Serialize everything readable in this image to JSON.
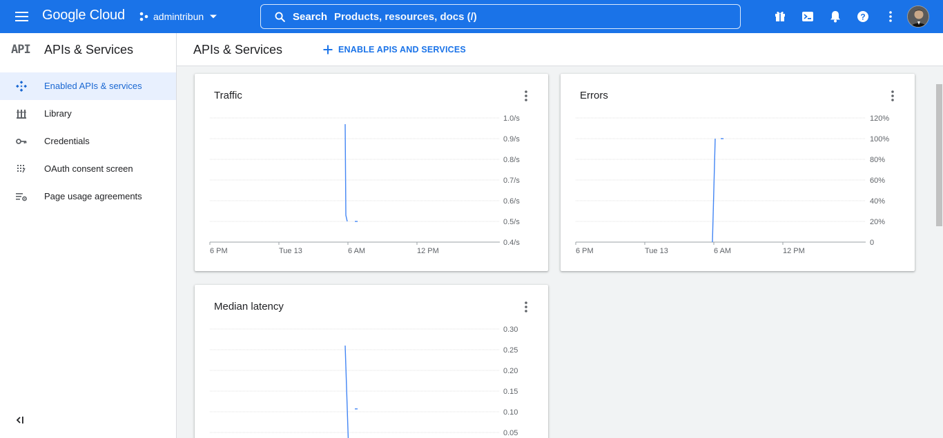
{
  "topbar": {
    "logo": "Google Cloud",
    "project": "admintribun",
    "search_keyword": "Search",
    "search_placeholder": "Products, resources, docs (/)"
  },
  "sidebar": {
    "mark": "API",
    "title": "APIs & Services",
    "items": [
      {
        "label": "Enabled APIs & services",
        "icon": "diamond-nodes-icon",
        "active": true
      },
      {
        "label": "Library",
        "icon": "library-icon",
        "active": false
      },
      {
        "label": "Credentials",
        "icon": "key-icon",
        "active": false
      },
      {
        "label": "OAuth consent screen",
        "icon": "consent-dots-icon",
        "active": false
      },
      {
        "label": "Page usage agreements",
        "icon": "list-settings-icon",
        "active": false
      }
    ]
  },
  "main": {
    "title": "APIs & Services",
    "enable_label": "ENABLE APIS AND SERVICES"
  },
  "colors": {
    "brand": "#1a73e8",
    "line": "#4285f4",
    "grid": "#e0e0e0"
  },
  "chart_data": [
    {
      "type": "line",
      "title": "Traffic",
      "ylabels": [
        "0.4/s",
        "0.5/s",
        "0.6/s",
        "0.7/s",
        "0.8/s",
        "0.9/s",
        "1.0/s"
      ],
      "ylim": [
        0.4,
        1.0
      ],
      "xlabels": [
        "6 PM",
        "Tue 13",
        "6 AM",
        "12 PM"
      ],
      "xlim": [
        0,
        21
      ],
      "xticks": [
        0,
        5,
        10,
        15
      ],
      "series": [
        {
          "points": [
            [
              9.8,
              0.97
            ],
            [
              9.85,
              0.53
            ],
            [
              9.95,
              0.5
            ]
          ]
        },
        {
          "points": [
            [
              10.5,
              0.5
            ],
            [
              10.7,
              0.5
            ]
          ]
        }
      ]
    },
    {
      "type": "line",
      "title": "Errors",
      "ylabels": [
        "0",
        "20%",
        "40%",
        "60%",
        "80%",
        "100%",
        "120%"
      ],
      "ylim": [
        0,
        120
      ],
      "xlabels": [
        "6 PM",
        "Tue 13",
        "6 AM",
        "12 PM"
      ],
      "xlim": [
        0,
        21
      ],
      "xticks": [
        0,
        5,
        10,
        15
      ],
      "series": [
        {
          "points": [
            [
              9.9,
              0
            ],
            [
              10.1,
              100
            ]
          ]
        },
        {
          "points": [
            [
              10.5,
              100
            ],
            [
              10.7,
              100
            ]
          ]
        }
      ]
    },
    {
      "type": "line",
      "title": "Median latency",
      "ylabels": [
        "0.05",
        "0.10",
        "0.15",
        "0.20",
        "0.25",
        "0.30"
      ],
      "ylim": [
        0.0,
        0.3
      ],
      "ytickvalues": [
        0.05,
        0.1,
        0.15,
        0.2,
        0.25,
        0.3
      ],
      "xlabels": [],
      "xlim": [
        0,
        21
      ],
      "xticks": [],
      "series": [
        {
          "points": [
            [
              9.8,
              0.26
            ],
            [
              10.05,
              0.0
            ]
          ]
        },
        {
          "points": [
            [
              10.5,
              0.107
            ],
            [
              10.7,
              0.107
            ]
          ]
        }
      ]
    }
  ]
}
